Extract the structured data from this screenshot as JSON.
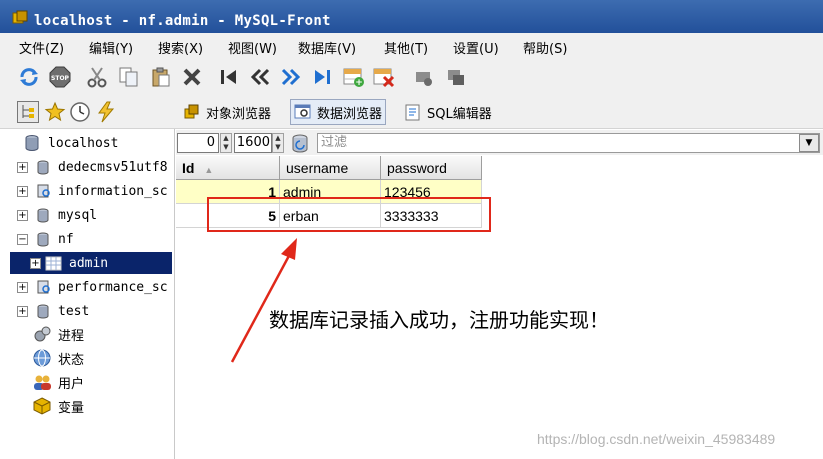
{
  "window": {
    "title": "localhost - nf.admin - MySQL-Front"
  },
  "menu": [
    "文件(Z)",
    "编辑(Y)",
    "搜索(X)",
    "视图(W)",
    "数据库(V)",
    "其他(T)",
    "设置(U)",
    "帮助(S)"
  ],
  "toolbar_icons": [
    "refresh-icon",
    "stop-icon",
    "cut-icon",
    "copy-icon",
    "paste-icon",
    "delete-icon",
    "first-record-icon",
    "previous-page-icon",
    "next-page-icon",
    "last-record-icon",
    "insert-record-icon",
    "delete-record-icon",
    "post-icon",
    "cancel-icon"
  ],
  "view_tabs": {
    "object_browser": "对象浏览器",
    "data_browser": "数据浏览器",
    "sql_editor": "SQL编辑器"
  },
  "filter": {
    "offset": "0",
    "limit": "1600",
    "placeholder": "过滤"
  },
  "tree": {
    "root": "localhost",
    "databases": [
      "dedecmsv51utf8",
      "information_sc",
      "mysql",
      "nf",
      "admin",
      "performance_sc",
      "test"
    ],
    "tools": [
      "进程",
      "状态",
      "用户",
      "变量"
    ]
  },
  "grid": {
    "columns": [
      "Id",
      "username",
      "password"
    ],
    "sort_indicator": "▲",
    "rows": [
      {
        "id": "1",
        "username": "admin",
        "password": "123456"
      },
      {
        "id": "5",
        "username": "erban",
        "password": "3333333"
      }
    ]
  },
  "annotation": "数据库记录插入成功，注册功能实现！",
  "watermark": "https://blog.csdn.net/weixin_45983489",
  "colors": {
    "titlebar": "#22509a",
    "selection": "#0a246a",
    "highlight_row": "#ffffc6",
    "annotation_red": "#e0281a"
  }
}
